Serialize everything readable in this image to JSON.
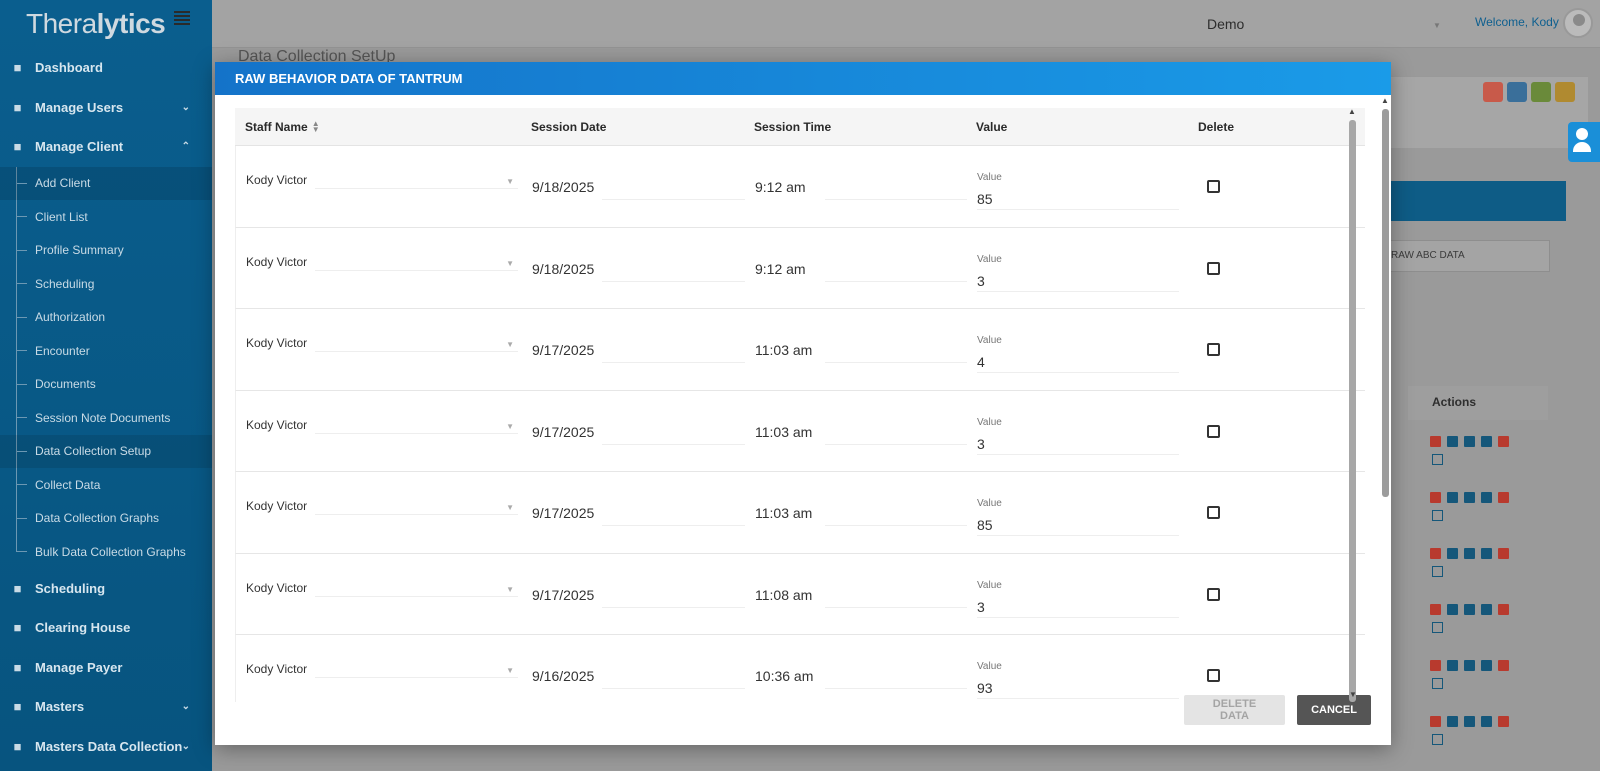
{
  "app": {
    "logo_regular": "Thera",
    "logo_bold": "lytics"
  },
  "header": {
    "account_select": "Demo",
    "welcome": "Welcome, Kody"
  },
  "sidebar": {
    "items": [
      {
        "label": "Dashboard",
        "icon": "dashboard-icon"
      },
      {
        "label": "Manage Users",
        "icon": "users-icon",
        "chevron": "down"
      },
      {
        "label": "Manage Client",
        "icon": "user-icon",
        "chevron": "up"
      }
    ],
    "client_sub": [
      "Add Client",
      "Client List",
      "Profile Summary",
      "Scheduling",
      "Authorization",
      "Encounter",
      "Documents",
      "Session Note Documents",
      "Data Collection Setup",
      "Collect Data",
      "Data Collection Graphs",
      "Bulk Data Collection Graphs"
    ],
    "bottom_items": [
      {
        "label": "Scheduling",
        "icon": "calendar-icon"
      },
      {
        "label": "Clearing House",
        "icon": "id-card-icon"
      },
      {
        "label": "Manage Payer",
        "icon": "payer-icon"
      },
      {
        "label": "Masters",
        "icon": "database-icon",
        "chevron": "down"
      },
      {
        "label": "Masters Data Collection",
        "icon": "database-icon",
        "chevron": "down"
      }
    ]
  },
  "background": {
    "page_title": "Data Collection SetUp",
    "raw_abc_label": "RAW ABC DATA",
    "actions_label": "Actions"
  },
  "modal": {
    "title": "RAW BEHAVIOR DATA OF TANTRUM",
    "columns": {
      "staff": "Staff Name",
      "date": "Session Date",
      "time": "Session Time",
      "value": "Value",
      "delete": "Delete"
    },
    "value_field_label": "Value",
    "rows": [
      {
        "staff": "Kody Victor",
        "date": "9/18/2025",
        "time": "9:12 am",
        "value": "85"
      },
      {
        "staff": "Kody Victor",
        "date": "9/18/2025",
        "time": "9:12 am",
        "value": "3"
      },
      {
        "staff": "Kody Victor",
        "date": "9/17/2025",
        "time": "11:03 am",
        "value": "4"
      },
      {
        "staff": "Kody Victor",
        "date": "9/17/2025",
        "time": "11:03 am",
        "value": "3"
      },
      {
        "staff": "Kody Victor",
        "date": "9/17/2025",
        "time": "11:03 am",
        "value": "85"
      },
      {
        "staff": "Kody Victor",
        "date": "9/17/2025",
        "time": "11:08 am",
        "value": "3"
      },
      {
        "staff": "Kody Victor",
        "date": "9/16/2025",
        "time": "10:36 am",
        "value": "93"
      }
    ],
    "buttons": {
      "delete": "DELETE DATA",
      "cancel": "CANCEL"
    }
  },
  "colors": {
    "sidebar_bg": "#0a5e8e",
    "modal_header": "#1a8fe0",
    "cancel_button": "#555555"
  }
}
